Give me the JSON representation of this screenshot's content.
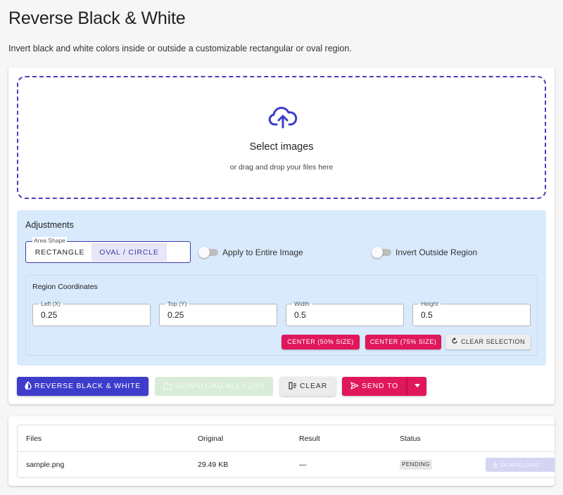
{
  "page": {
    "title": "Reverse Black & White",
    "description": "Invert black and white colors inside or outside a customizable rectangular or oval region."
  },
  "dropzone": {
    "title": "Select images",
    "subtitle": "or drag and drop your files here",
    "icon": "cloud-upload-icon"
  },
  "adjustments": {
    "title": "Adjustments",
    "area_shape": {
      "legend": "Area Shape",
      "options": [
        "RECTANGLE",
        "OVAL / CIRCLE"
      ],
      "selected": "OVAL / CIRCLE"
    },
    "apply_entire": {
      "label": "Apply to Entire Image",
      "on": false
    },
    "invert_outside": {
      "label": "Invert Outside Region",
      "on": false
    },
    "region": {
      "title": "Region Coordinates",
      "fields": [
        {
          "label": "Left (X)",
          "value": "0.25"
        },
        {
          "label": "Top (Y)",
          "value": "0.25"
        },
        {
          "label": "Width",
          "value": "0.5"
        },
        {
          "label": "Height",
          "value": "0.5"
        }
      ],
      "center50_label": "CENTER (50% SIZE)",
      "center75_label": "CENTER (75% SIZE)",
      "clear_selection_label": "CLEAR SELECTION"
    }
  },
  "actions": {
    "reverse_label": "REVERSE BLACK & WHITE",
    "download_all_label": "DOWNLOAD ALL (.ZIP)",
    "clear_label": "CLEAR",
    "send_to_label": "SEND TO"
  },
  "files": {
    "columns": [
      "Files",
      "Original",
      "Result",
      "Status"
    ],
    "rows": [
      {
        "name": "sample.png",
        "original": "29.49 KB",
        "result": "—",
        "status": "PENDING",
        "download_label": "DOWNLOAD"
      }
    ]
  },
  "colors": {
    "primary": "#3d3ccb",
    "accent": "#e0175b",
    "dropzone_border": "#4a3fb8",
    "adjust_bg": "#d8eafc"
  }
}
